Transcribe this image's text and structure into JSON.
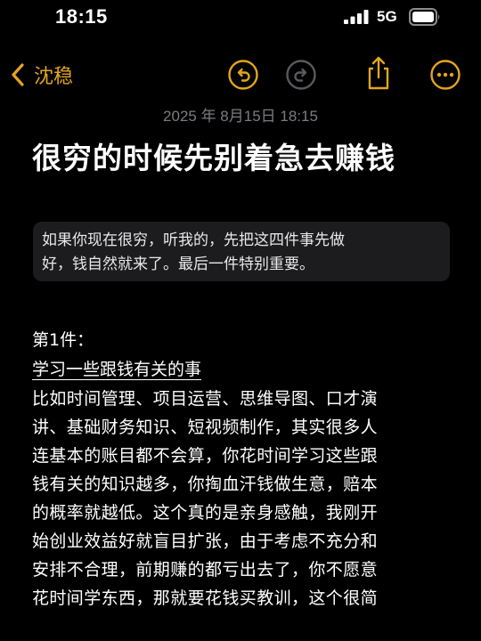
{
  "status_bar": {
    "time": "18:15",
    "network": "5G",
    "icons": [
      "signal-icon",
      "battery-icon"
    ]
  },
  "nav": {
    "back_label": "沈稳",
    "icons": [
      "chevron-left-icon",
      "undo-icon",
      "redo-icon",
      "share-icon",
      "more-icon"
    ],
    "accent_color": "#E3A520"
  },
  "note": {
    "date": "2025 年 8月15日 18:15",
    "title": "很穷的时候先别着急去赚钱",
    "quote": {
      "lines": [
        "如果你现在很穷，听我的，先把这四件事先做",
        "好，钱自然就来了。最后一件特别重要。"
      ]
    },
    "section": {
      "heading": "第1件：",
      "subheading": "学习一些跟钱有关的事",
      "body_lines": [
        "比如时间管理、项目运营、思维导图、口才演",
        "讲、基础财务知识、短视频制作，其实很多人",
        "连基本的账目都不会算，你花时间学习这些跟",
        "钱有关的知识越多，你掏血汗钱做生意，赔本",
        "的概率就越低。这个真的是亲身感触，我刚开",
        "始创业效益好就盲目扩张，由于考虑不充分和",
        "安排不合理，前期赚的都亏出去了，你不愿意",
        "花时间学东西，那就要花钱买教训，这个很简"
      ]
    }
  }
}
